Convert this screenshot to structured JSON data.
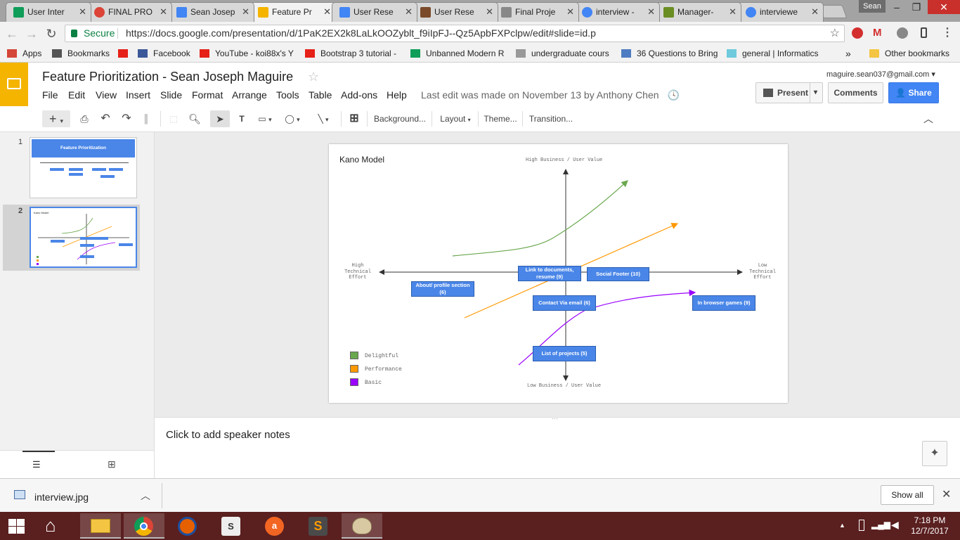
{
  "browser": {
    "tabs": [
      {
        "label": "User Inter",
        "icon": "sheets-icon",
        "color": "#0f9d58"
      },
      {
        "label": "FINAL PRO",
        "icon": "circle-icon",
        "color": "#db4437"
      },
      {
        "label": "Sean Josep",
        "icon": "drive-icon",
        "color": "#4285f4"
      },
      {
        "label": "Feature Pr",
        "icon": "slides-icon",
        "color": "#f4b400",
        "active": true
      },
      {
        "label": "User Rese",
        "icon": "docs-icon",
        "color": "#4285f4"
      },
      {
        "label": "User Rese",
        "icon": "image-icon",
        "color": "#7a4a2a"
      },
      {
        "label": "Final Proje",
        "icon": "page-icon",
        "color": "#888888"
      },
      {
        "label": "interview -",
        "icon": "google-icon",
        "color": "#4285f4"
      },
      {
        "label": "Manager-",
        "icon": "c-icon",
        "color": "#6b8e23"
      },
      {
        "label": "interviewe",
        "icon": "google-icon",
        "color": "#4285f4"
      }
    ],
    "profile_name": "Sean",
    "secure_label": "Secure",
    "url": "https://docs.google.com/presentation/d/1PaK2EX2k8LaLkOOZyblt_f9iIpFJ--Qz5ApbFXPclpw/edit#slide=id.p",
    "bookmarks": [
      {
        "label": "Apps",
        "icon": "apps-grid-icon"
      },
      {
        "label": "Bookmarks",
        "icon": "star-icon"
      },
      {
        "label": "",
        "icon": "youtube-icon"
      },
      {
        "label": "Facebook",
        "icon": "facebook-icon"
      },
      {
        "label": "YouTube - koi88x's Y",
        "icon": "youtube-icon"
      },
      {
        "label": "Bootstrap 3 tutorial -",
        "icon": "youtube-icon"
      },
      {
        "label": "Unbanned Modern R",
        "icon": "sheets-icon"
      },
      {
        "label": "undergraduate cours",
        "icon": "page-icon"
      },
      {
        "label": "36 Questions to Bring",
        "icon": "pt-icon"
      },
      {
        "label": "general | Informatics",
        "icon": "slack-icon"
      }
    ],
    "other_bookmarks": "Other bookmarks",
    "overflow": "»"
  },
  "docs": {
    "title": "Feature Prioritization - Sean Joseph Maguire",
    "menus": [
      "File",
      "Edit",
      "View",
      "Insert",
      "Slide",
      "Format",
      "Arrange",
      "Tools",
      "Table",
      "Add-ons",
      "Help"
    ],
    "last_edit": "Last edit was made on November 13 by Anthony Chen",
    "email": "maguire.sean037@gmail.com",
    "present_label": "Present",
    "comments_label": "Comments",
    "share_label": "Share",
    "toolbar": {
      "background": "Background...",
      "layout": "Layout",
      "theme": "Theme...",
      "transition": "Transition..."
    }
  },
  "filmstrip": {
    "slides": [
      {
        "number": "1",
        "title": "Feature Prioritization"
      },
      {
        "number": "2",
        "title": "Kano Model"
      }
    ]
  },
  "slide": {
    "title": "Kano Model",
    "axis_top": "High Business / User Value",
    "axis_bottom": "Low Business / User Value",
    "axis_left": [
      "High",
      "Technical",
      "Effort"
    ],
    "axis_right": [
      "Low",
      "Technical",
      "Effort"
    ],
    "features": [
      {
        "id": "about",
        "label": "About/ profile section (6)"
      },
      {
        "id": "link",
        "label": "Link to documents, resume (9)"
      },
      {
        "id": "social",
        "label": "Social Footer (10)"
      },
      {
        "id": "contact",
        "label": "Contact Via email (6)"
      },
      {
        "id": "browser",
        "label": "In browser games (9)"
      },
      {
        "id": "projects",
        "label": "List of projects (5)"
      }
    ],
    "legend": [
      {
        "label": "Delightful",
        "color": "#6aa84f"
      },
      {
        "label": "Performance",
        "color": "#ff9900"
      },
      {
        "label": "Basic",
        "color": "#9900ff"
      }
    ]
  },
  "notes": {
    "placeholder": "Click to add speaker notes"
  },
  "downloads": {
    "filename": "interview.jpg",
    "show_all": "Show all"
  },
  "taskbar": {
    "time": "7:18 PM",
    "date": "12/7/2017"
  }
}
